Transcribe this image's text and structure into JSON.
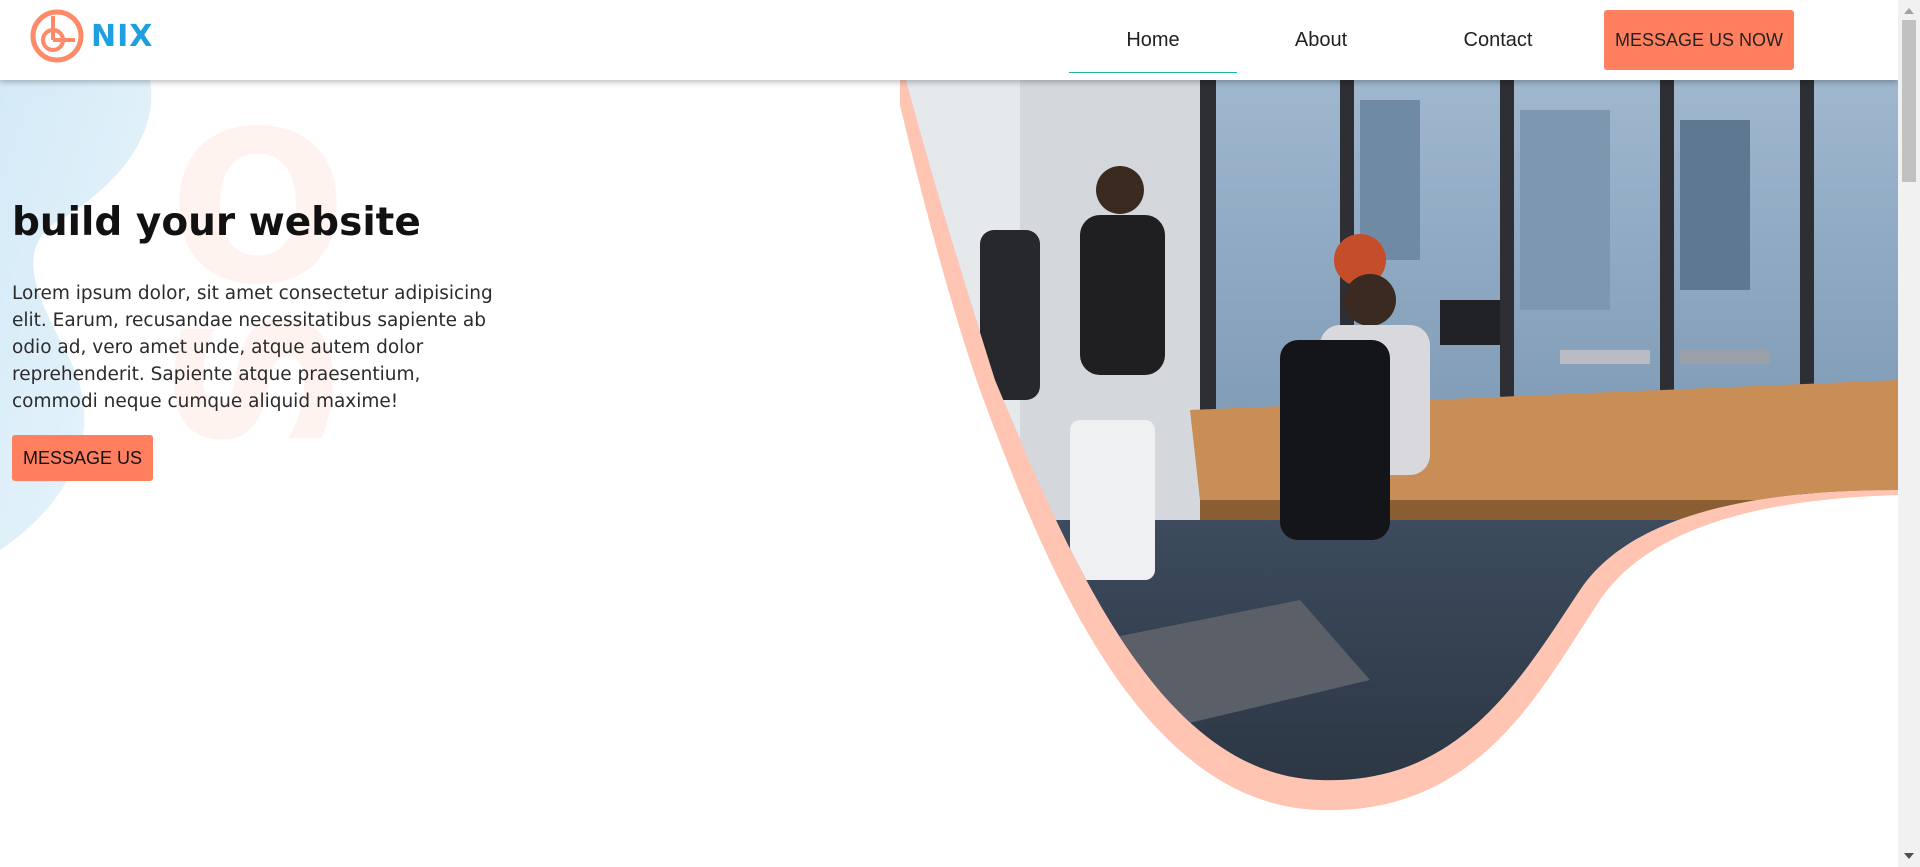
{
  "brand": {
    "name": "NIX",
    "logo_icon": "target-logo-icon"
  },
  "nav": [
    {
      "label": "Home",
      "active": true
    },
    {
      "label": "About"
    },
    {
      "label": "Contact"
    }
  ],
  "header_cta": "MESSAGE US NOW",
  "hero": {
    "title": "build your website",
    "text": "Lorem ipsum dolor, sit amet consectetur adipisicing elit. Earum, recusandae necessitatibus sapiente ab odio ad, vero amet unde, atque autem dolor reprehenderit. Sapiente atque praesentium, commodi neque cumque aliquid maxime!",
    "button": "MESSAGE US"
  },
  "watermark": {
    "line1": "O",
    "line2": "S"
  },
  "colors": {
    "accent": "#ff7f5f",
    "brand_blue": "#1e9fe0",
    "nav_underline": "#22b3a3",
    "blob_blue": "#d6ecf8",
    "blob_peach": "#ffc4b2"
  }
}
